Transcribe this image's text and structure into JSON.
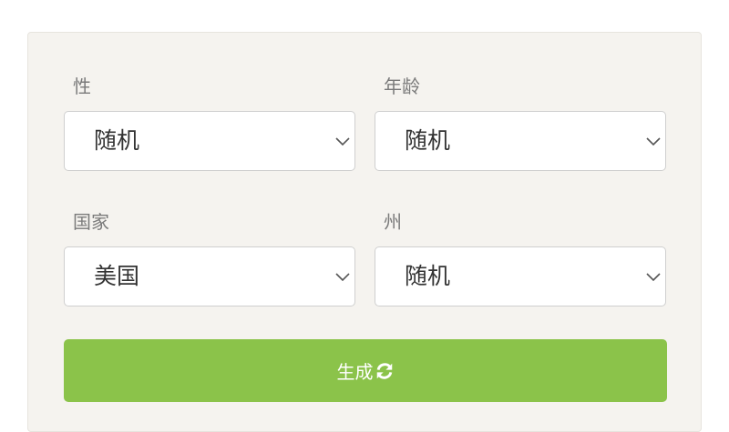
{
  "form": {
    "gender": {
      "label": "性",
      "value": "随机"
    },
    "age": {
      "label": "年龄",
      "value": "随机"
    },
    "country": {
      "label": "国家",
      "value": "美国"
    },
    "state": {
      "label": "州",
      "value": "随机"
    },
    "generate_label": "生成"
  },
  "icons": {
    "select_arrow": "chevron-down-icon",
    "generate": "refresh-icon"
  },
  "colors": {
    "button_green": "#8bc34a",
    "panel_background": "#f5f3ef"
  }
}
